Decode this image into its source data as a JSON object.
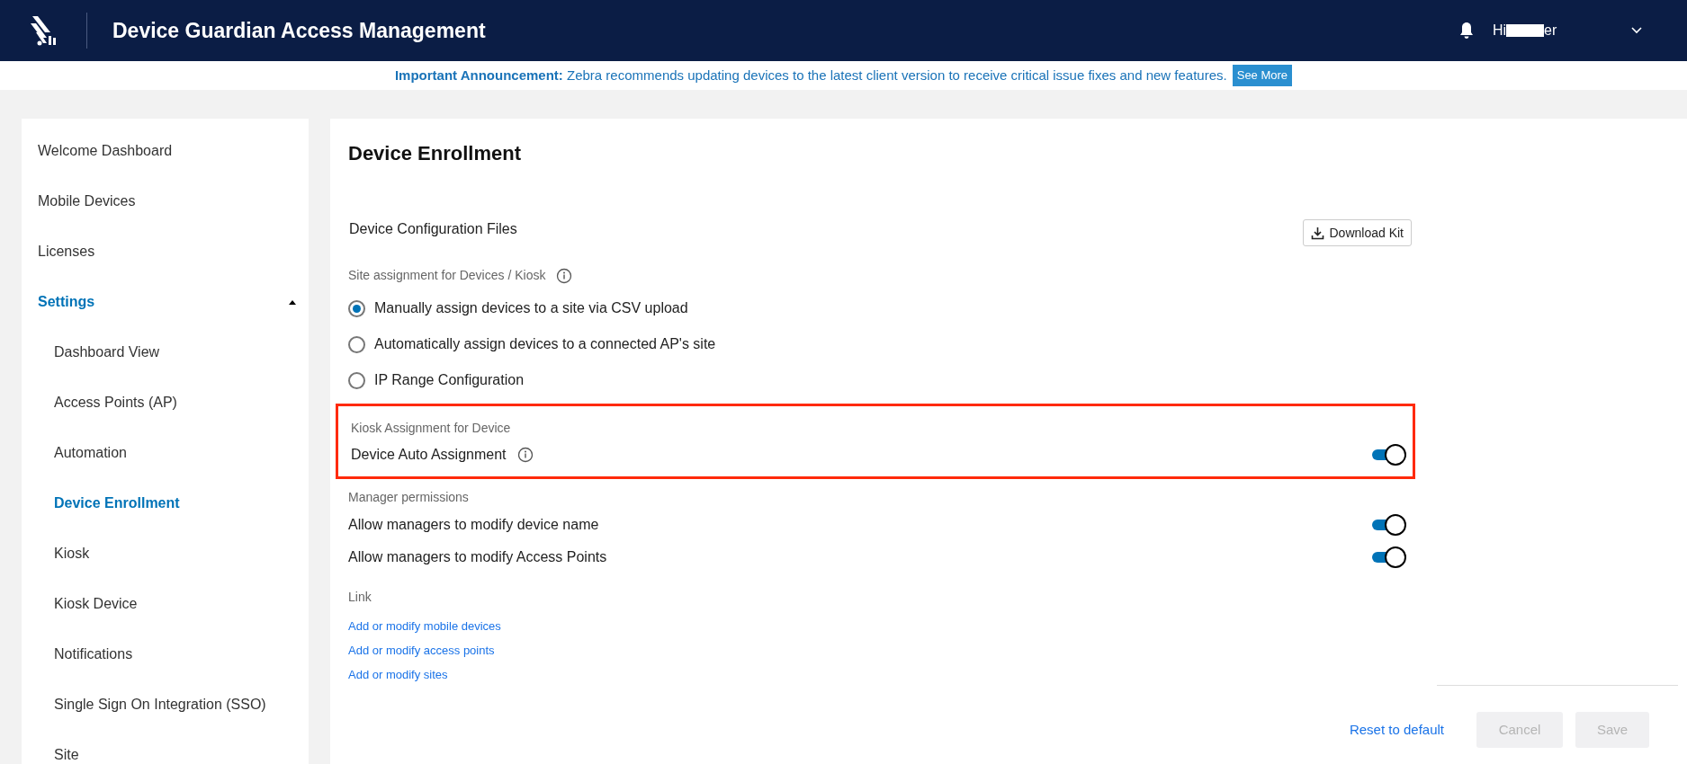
{
  "header": {
    "title": "Device Guardian Access Management",
    "greeting": "Hi",
    "name_tail": "er",
    "name_redacted": true
  },
  "announcement": {
    "label": "Important Announcement:",
    "message": "Zebra recommends updating devices to the latest client version to receive critical issue fixes and new features.",
    "button": "See More"
  },
  "sidebar": {
    "items": [
      {
        "label": "Welcome Dashboard",
        "selected": false
      },
      {
        "label": "Mobile Devices",
        "selected": false
      },
      {
        "label": "Licenses",
        "selected": false
      },
      {
        "label": "Settings",
        "selected": true,
        "expanded": true,
        "children": [
          {
            "label": "Dashboard View",
            "selected": false
          },
          {
            "label": "Access Points (AP)",
            "selected": false
          },
          {
            "label": "Automation",
            "selected": false
          },
          {
            "label": "Device Enrollment",
            "selected": true
          },
          {
            "label": "Kiosk",
            "selected": false
          },
          {
            "label": "Kiosk Device",
            "selected": false
          },
          {
            "label": "Notifications",
            "selected": false
          },
          {
            "label": "Single Sign On Integration (SSO)",
            "selected": false
          },
          {
            "label": "Site",
            "selected": false
          }
        ]
      }
    ]
  },
  "main": {
    "title": "Device Enrollment",
    "config_files": {
      "label": "Device Configuration Files",
      "button": "Download Kit"
    },
    "site_assignment": {
      "label": "Site assignment for Devices / Kiosk",
      "options": [
        {
          "label": "Manually assign devices to a site via CSV upload",
          "selected": true
        },
        {
          "label": "Automatically assign devices to a connected AP's site",
          "selected": false
        },
        {
          "label": "IP Range Configuration",
          "selected": false
        }
      ]
    },
    "kiosk_assignment": {
      "label": "Kiosk Assignment for Device",
      "highlighted": true,
      "toggles": [
        {
          "label": "Device Auto Assignment",
          "on": true,
          "info": true
        }
      ]
    },
    "manager_permissions": {
      "label": "Manager permissions",
      "toggles": [
        {
          "label": "Allow managers to modify device name",
          "on": true,
          "info": false
        },
        {
          "label": "Allow managers to modify Access Points",
          "on": true,
          "info": false
        }
      ]
    },
    "links": {
      "label": "Link",
      "items": [
        "Add or modify mobile devices",
        "Add or modify access points",
        "Add or modify sites"
      ]
    },
    "footer": {
      "reset": "Reset to default",
      "buttons": [
        {
          "label": "Cancel",
          "disabled": true
        },
        {
          "label": "Save",
          "disabled": true
        }
      ]
    }
  }
}
